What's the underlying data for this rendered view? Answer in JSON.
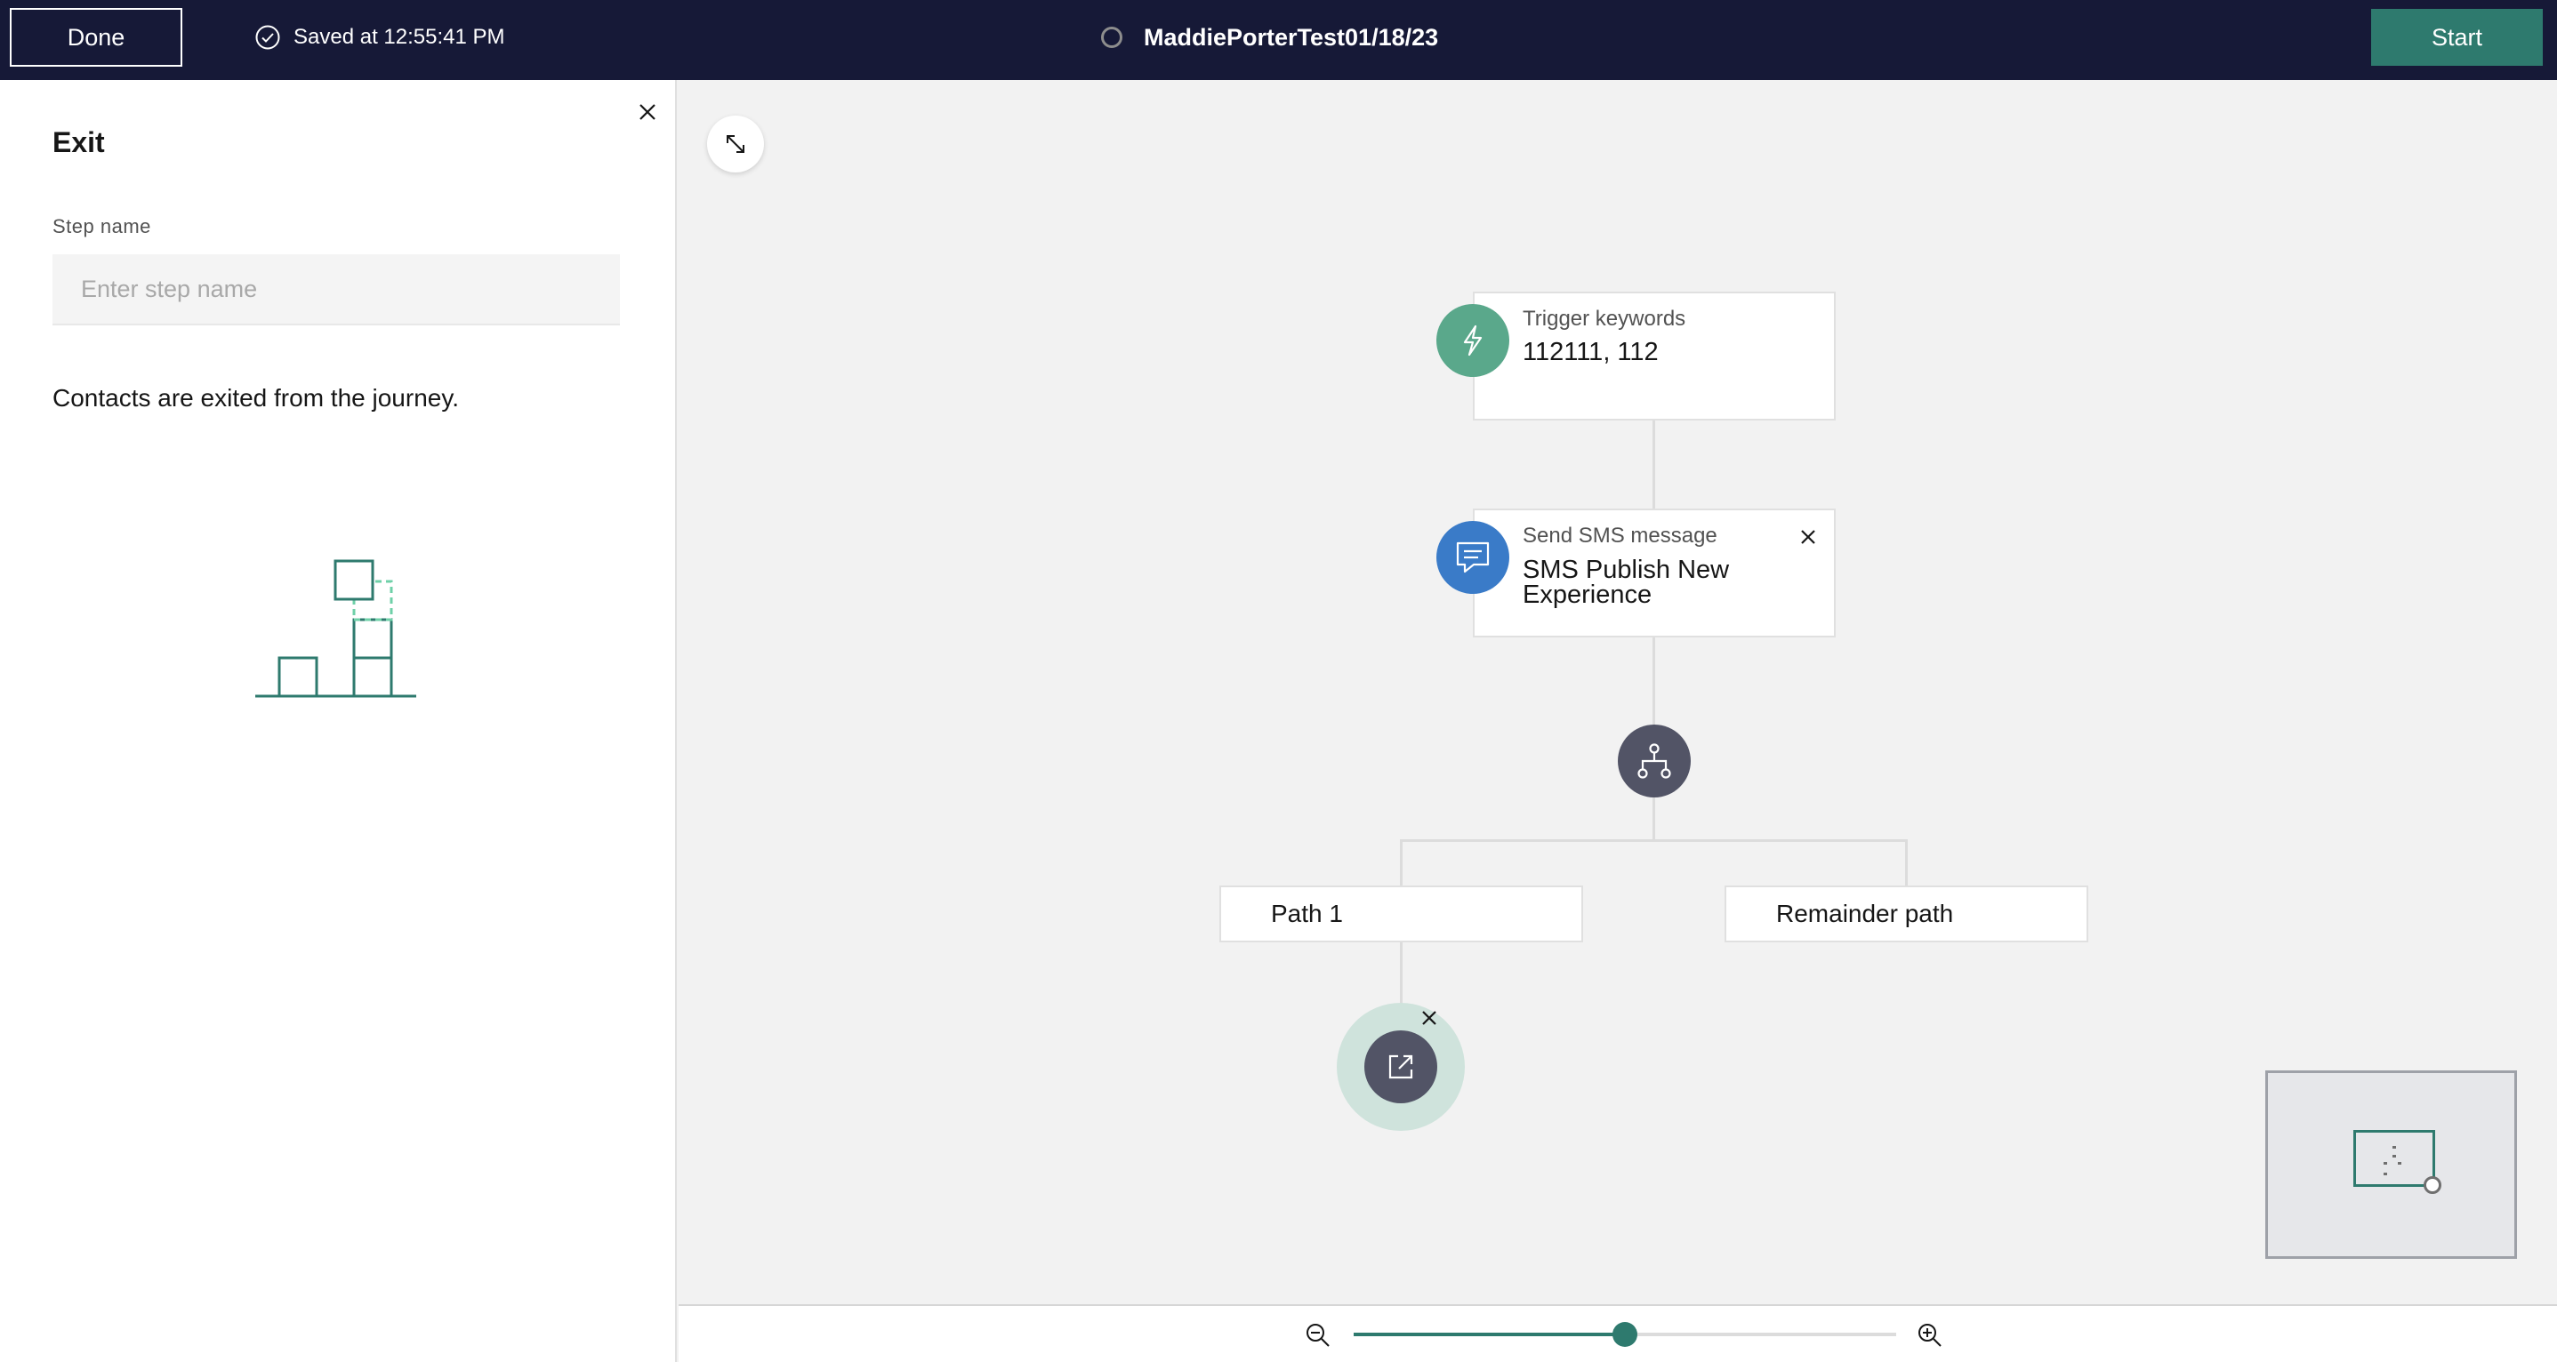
{
  "header": {
    "done_label": "Done",
    "saved_text": "Saved at 12:55:41 PM",
    "journey_title": "MaddiePorterTest01/18/23",
    "start_label": "Start"
  },
  "panel": {
    "title": "Exit",
    "step_name_label": "Step name",
    "step_name_placeholder": "Enter step name",
    "step_name_value": "",
    "description": "Contacts are exited from the journey."
  },
  "canvas": {
    "trigger": {
      "label": "Trigger keywords",
      "value": "112111, 112",
      "icon": "lightning-icon",
      "color": "#5aa88b"
    },
    "sms": {
      "label": "Send SMS message",
      "value_line1": "SMS Publish New",
      "value_line2": "Experience",
      "icon": "chat-bubble-icon",
      "color": "#3a7bc8"
    },
    "split": {
      "icon": "split-icon",
      "color": "#525466"
    },
    "paths": [
      {
        "label": "Path 1"
      },
      {
        "label": "Remainder path"
      }
    ],
    "exit": {
      "icon": "exit-icon",
      "selected": true
    }
  },
  "zoom": {
    "level": 0.5
  },
  "colors": {
    "header_bg": "#161937",
    "accent": "#2e7a6e"
  }
}
